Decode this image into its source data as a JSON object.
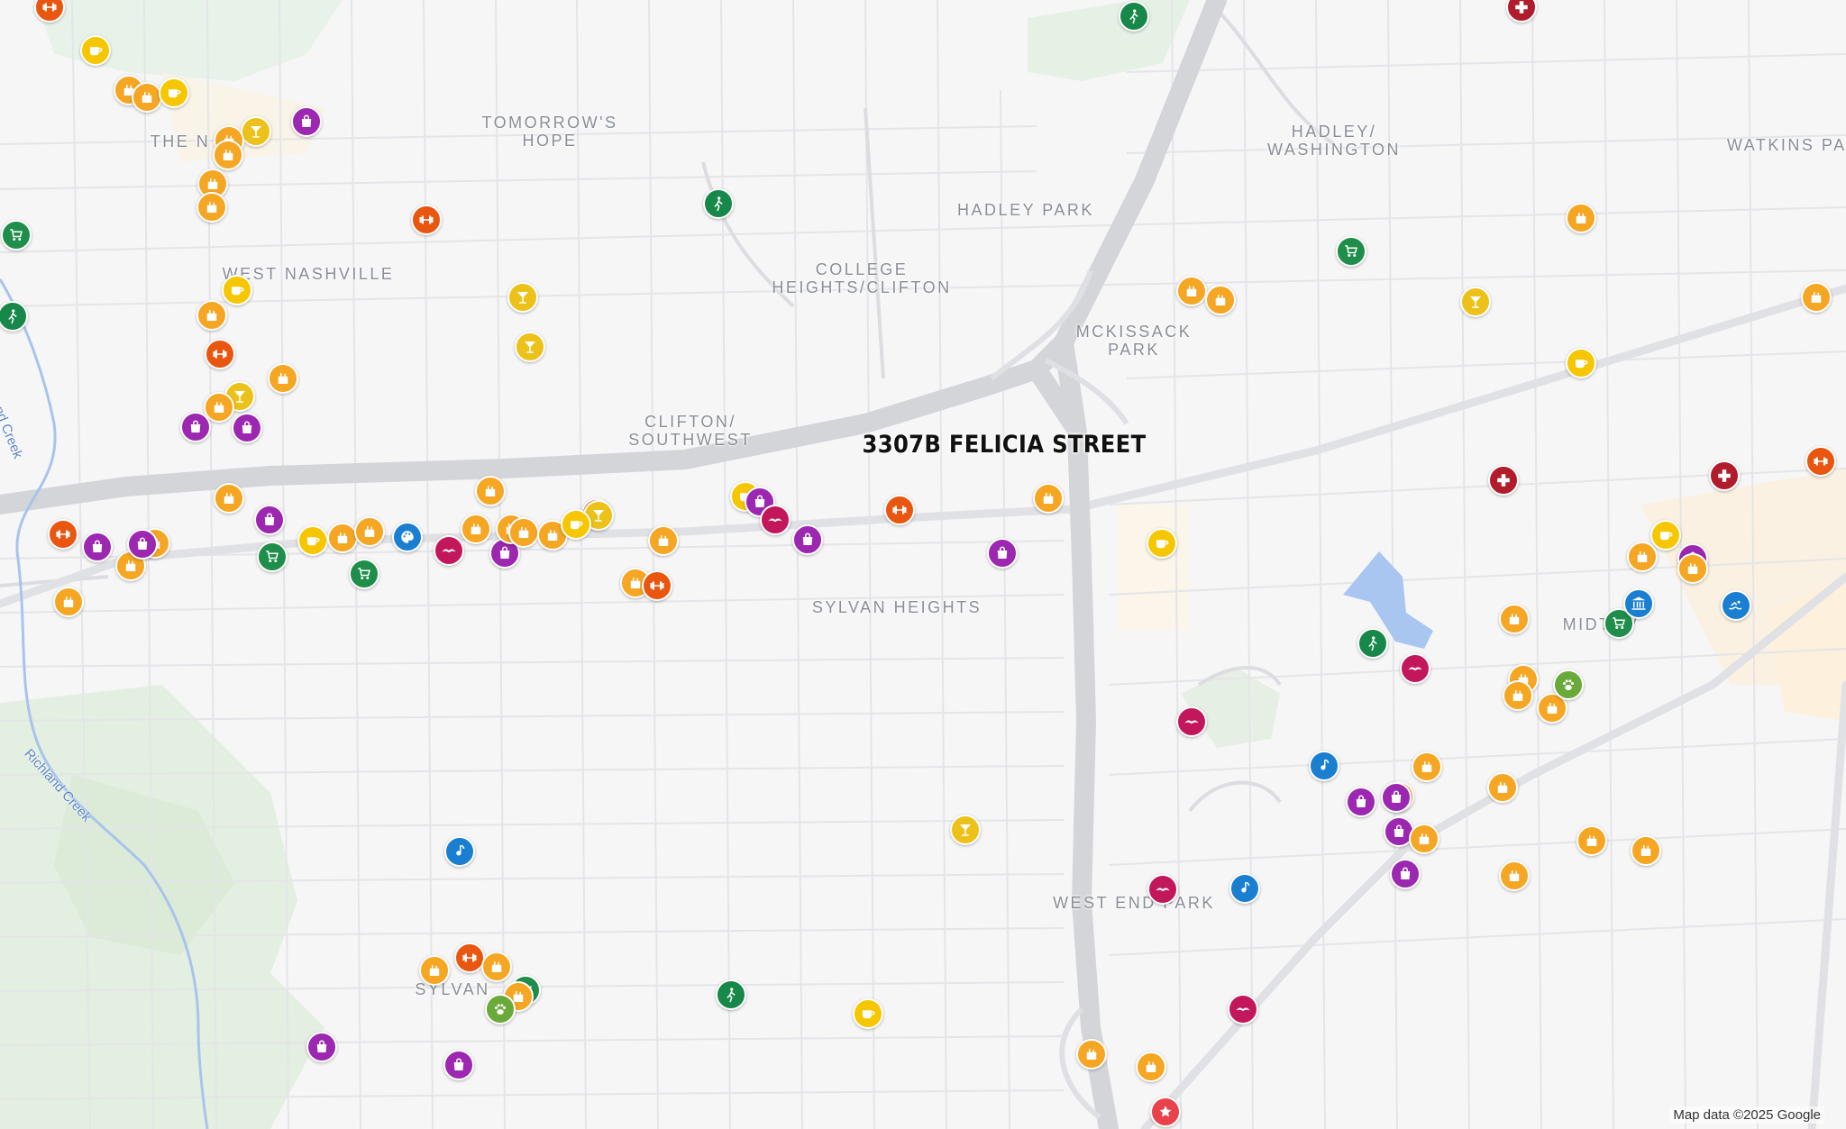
{
  "map": {
    "property_label": "3307B FELICIA STREET",
    "attribution": "Map data ©2025 Google",
    "area_labels": [
      "TOMORROW'S\nHOPE",
      "HADLEY/\nWASHINGTON",
      "WATKINS PAR",
      "HADLEY PARK",
      "THE N",
      "COLLEGE\nHEIGHTS/CLIFTON",
      "WEST NASHVILLE",
      "MCKISSACK\nPARK",
      "CLIFTON/\nSOUTHWEST",
      "SYLVAN HEIGHTS",
      "MIDTOV",
      "WEST END PARK",
      "SYLVAN"
    ],
    "water_labels": [
      "Richland Creek",
      "Richland Creek"
    ]
  },
  "pin_colors": {
    "food": "#f5a623",
    "shop": "#9c27b0",
    "grocery": "#1e8e4a",
    "park": "#17884a",
    "gym": "#e8560f",
    "bar": "#ecc21a",
    "cafe": "#f6c700",
    "health": "#b01c2b",
    "barber": "#c2185b",
    "music": "#1a7fd1",
    "museum": "#1a7fd1",
    "art": "#1a7fd1",
    "swim": "#1a7fd1",
    "pet": "#6aaa3a",
    "property": "#e8434d"
  },
  "pins": [
    {
      "name": "fitness-center-icon",
      "cat": "gym"
    },
    {
      "name": "walking-trail-icon",
      "cat": "park"
    },
    {
      "name": "hospital-icon",
      "cat": "health"
    },
    {
      "name": "cafe-icon",
      "cat": "cafe"
    },
    {
      "name": "restaurant-icon",
      "cat": "food"
    },
    {
      "name": "restaurant-icon",
      "cat": "food"
    },
    {
      "name": "cafe-icon",
      "cat": "cafe"
    },
    {
      "name": "shopping-bag-icon",
      "cat": "shop"
    },
    {
      "name": "cocktail-bar-icon",
      "cat": "bar"
    },
    {
      "name": "restaurant-icon",
      "cat": "food"
    },
    {
      "name": "restaurant-icon",
      "cat": "food"
    },
    {
      "name": "restaurant-icon",
      "cat": "food"
    },
    {
      "name": "restaurant-icon",
      "cat": "food"
    },
    {
      "name": "grocery-cart-icon",
      "cat": "grocery"
    },
    {
      "name": "walking-trail-icon",
      "cat": "park"
    },
    {
      "name": "fitness-center-icon",
      "cat": "gym"
    },
    {
      "name": "cafe-icon",
      "cat": "cafe"
    },
    {
      "name": "restaurant-icon",
      "cat": "food"
    },
    {
      "name": "fitness-center-icon",
      "cat": "gym"
    },
    {
      "name": "bakery-icon",
      "cat": "food"
    },
    {
      "name": "cocktail-bar-icon",
      "cat": "bar"
    },
    {
      "name": "restaurant-icon",
      "cat": "food"
    },
    {
      "name": "shopping-bag-icon",
      "cat": "shop"
    },
    {
      "name": "shopping-bag-icon",
      "cat": "shop"
    },
    {
      "name": "cocktail-bar-icon",
      "cat": "bar"
    },
    {
      "name": "cocktail-bar-icon",
      "cat": "bar"
    },
    {
      "name": "walking-trail-icon",
      "cat": "park"
    },
    {
      "name": "restaurant-icon",
      "cat": "food"
    },
    {
      "name": "restaurant-icon",
      "cat": "food"
    },
    {
      "name": "grocery-cart-icon",
      "cat": "grocery"
    },
    {
      "name": "cocktail-bar-icon",
      "cat": "bar"
    },
    {
      "name": "restaurant-icon",
      "cat": "food"
    },
    {
      "name": "restaurant-icon",
      "cat": "food"
    },
    {
      "name": "cafe-icon",
      "cat": "cafe"
    },
    {
      "name": "hospital-icon",
      "cat": "health"
    },
    {
      "name": "hospital-icon",
      "cat": "health"
    },
    {
      "name": "fitness-center-icon",
      "cat": "gym"
    },
    {
      "name": "fitness-center-icon",
      "cat": "gym"
    },
    {
      "name": "shopping-bag-icon",
      "cat": "shop"
    },
    {
      "name": "restaurant-icon",
      "cat": "food"
    },
    {
      "name": "restaurant-icon",
      "cat": "food"
    },
    {
      "name": "shopping-bag-icon",
      "cat": "shop"
    },
    {
      "name": "shopping-bag-icon",
      "cat": "shop"
    },
    {
      "name": "grocery-cart-icon",
      "cat": "grocery"
    },
    {
      "name": "grocery-cart-icon",
      "cat": "grocery"
    },
    {
      "name": "art-gallery-icon",
      "cat": "art"
    },
    {
      "name": "barber-icon",
      "cat": "barber"
    },
    {
      "name": "shopping-bag-icon",
      "cat": "shop"
    },
    {
      "name": "restaurant-icon",
      "cat": "food"
    },
    {
      "name": "restaurant-icon",
      "cat": "food"
    },
    {
      "name": "restaurant-icon",
      "cat": "food"
    },
    {
      "name": "fitness-center-icon",
      "cat": "gym"
    },
    {
      "name": "cafe-icon",
      "cat": "cafe"
    },
    {
      "name": "restaurant-icon",
      "cat": "food"
    },
    {
      "name": "restaurant-icon",
      "cat": "food"
    },
    {
      "name": "shopping-bag-icon",
      "cat": "shop"
    },
    {
      "name": "restaurant-icon",
      "cat": "food"
    },
    {
      "name": "restaurant-icon",
      "cat": "food"
    },
    {
      "name": "restaurant-icon",
      "cat": "food"
    },
    {
      "name": "cafe-icon",
      "cat": "cafe"
    },
    {
      "name": "shopping-bag-icon",
      "cat": "shop"
    },
    {
      "name": "shopping-bag-icon",
      "cat": "shop"
    },
    {
      "name": "fitness-center-icon",
      "cat": "gym"
    },
    {
      "name": "restaurant-icon",
      "cat": "food"
    },
    {
      "name": "restaurant-icon",
      "cat": "food"
    },
    {
      "name": "barber-icon",
      "cat": "barber"
    },
    {
      "name": "restaurant-icon",
      "cat": "food"
    },
    {
      "name": "restaurant-icon",
      "cat": "food"
    },
    {
      "name": "fitness-center-icon",
      "cat": "gym"
    },
    {
      "name": "cocktail-bar-icon",
      "cat": "bar"
    },
    {
      "name": "cafe-icon",
      "cat": "cafe"
    },
    {
      "name": "cafe-icon",
      "cat": "cafe"
    },
    {
      "name": "cafe-icon",
      "cat": "cafe"
    },
    {
      "name": "restaurant-icon",
      "cat": "food"
    },
    {
      "name": "shopping-bag-icon",
      "cat": "shop"
    },
    {
      "name": "restaurant-icon",
      "cat": "food"
    },
    {
      "name": "swimming-pool-icon",
      "cat": "swim"
    },
    {
      "name": "restaurant-icon",
      "cat": "food"
    },
    {
      "name": "playground-icon",
      "cat": "grocery"
    },
    {
      "name": "museum-icon",
      "cat": "museum"
    },
    {
      "name": "walking-trail-icon",
      "cat": "park"
    },
    {
      "name": "barber-icon",
      "cat": "barber"
    },
    {
      "name": "restaurant-icon",
      "cat": "food"
    },
    {
      "name": "restaurant-icon",
      "cat": "food"
    },
    {
      "name": "restaurant-icon",
      "cat": "food"
    },
    {
      "name": "dog-park-icon",
      "cat": "pet"
    },
    {
      "name": "barber-icon",
      "cat": "barber"
    },
    {
      "name": "music-venue-icon",
      "cat": "music"
    },
    {
      "name": "restaurant-icon",
      "cat": "food"
    },
    {
      "name": "cocktail-bar-icon",
      "cat": "bar"
    },
    {
      "name": "restaurant-icon",
      "cat": "food"
    },
    {
      "name": "shopping-bag-icon",
      "cat": "shop"
    },
    {
      "name": "shopping-bag-icon",
      "cat": "shop"
    },
    {
      "name": "shopping-bag-icon",
      "cat": "shop"
    },
    {
      "name": "restaurant-icon",
      "cat": "food"
    },
    {
      "name": "shopping-bag-icon",
      "cat": "shop"
    },
    {
      "name": "restaurant-icon",
      "cat": "food"
    },
    {
      "name": "restaurant-icon",
      "cat": "food"
    },
    {
      "name": "music-venue-icon",
      "cat": "music"
    },
    {
      "name": "barber-icon",
      "cat": "barber"
    },
    {
      "name": "restaurant-icon",
      "cat": "food"
    },
    {
      "name": "pill-pharmacy-icon",
      "cat": "music"
    },
    {
      "name": "fitness-center-icon",
      "cat": "gym"
    },
    {
      "name": "restaurant-icon",
      "cat": "food"
    },
    {
      "name": "restaurant-icon",
      "cat": "food"
    },
    {
      "name": "restaurant-icon",
      "cat": "food"
    },
    {
      "name": "grocery-cart-icon",
      "cat": "grocery"
    },
    {
      "name": "restaurant-icon",
      "cat": "food"
    },
    {
      "name": "hiking-icon",
      "cat": "pet"
    },
    {
      "name": "walking-trail-icon",
      "cat": "park"
    },
    {
      "name": "shopping-bag-icon",
      "cat": "shop"
    },
    {
      "name": "shopping-bag-icon",
      "cat": "shop"
    },
    {
      "name": "cafe-icon",
      "cat": "cafe"
    },
    {
      "name": "barber-icon",
      "cat": "barber"
    },
    {
      "name": "restaurant-icon",
      "cat": "food"
    },
    {
      "name": "restaurant-icon",
      "cat": "food"
    },
    {
      "name": "property-star-icon",
      "cat": "property"
    }
  ]
}
